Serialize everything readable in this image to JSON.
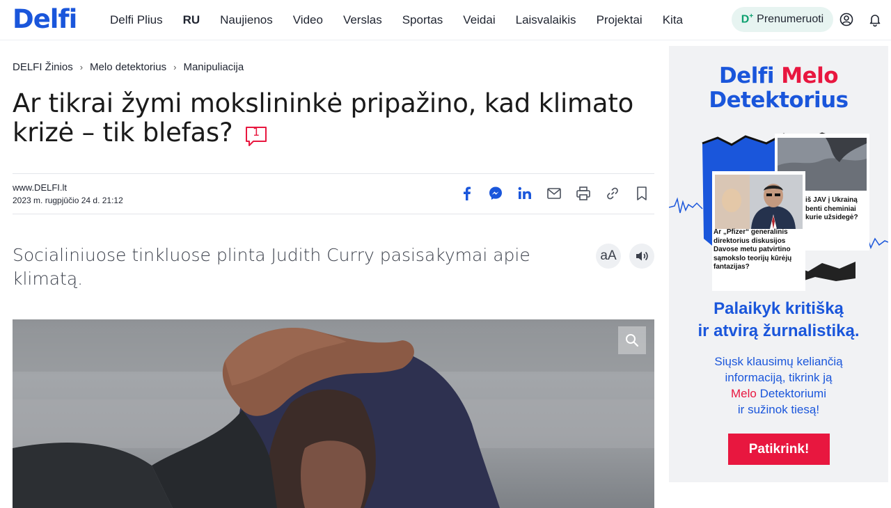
{
  "header": {
    "logo": "Delfi",
    "nav": [
      "Delfi Plius",
      "RU",
      "Naujienos",
      "Video",
      "Verslas",
      "Sportas",
      "Veidai",
      "Laisvalaikis",
      "Projektai",
      "Kita"
    ],
    "subscribe_mark": "D",
    "subscribe_label": "Prenumeruoti"
  },
  "breadcrumb": [
    "DELFI Žinios",
    "Melo detektorius",
    "Manipuliacija"
  ],
  "article": {
    "title": "Ar tikrai žymi mokslininkė pripažino, kad klimato krizė – tik blefas?",
    "comment_count": "1",
    "source": "www.DELFI.lt",
    "date": "2023 m. rugpjūčio 24 d. 21:12",
    "lead": "Socialiniuose tinkluose plinta Judith Curry pasisakymai apie klimatą.",
    "font_toggle": "aA"
  },
  "ad": {
    "title_a": "Delfi ",
    "title_b": "Melo",
    "title_c": "Detektorius",
    "card1_text": "Ar „Pfizer“ generalinis direktorius diskusijos Davose metu patvirtino sąmokslo teorijų kūrėjų fantazijas?",
    "card2_text": "iš JAV į Ukrainą benti cheminiai kurie užsidegė?",
    "headline_1": "Palaikyk kritišką",
    "headline_2": "ir atvirą žurnalistiką.",
    "body_1": "Siųsk klausimų keliančią",
    "body_2": "informaciją, tikrink ją",
    "body_3_red": "Melo",
    "body_3_rest": " Detektoriumi",
    "body_4": "ir sužinok tiesą!",
    "cta": "Patikrink!"
  },
  "colors": {
    "brand_blue": "#1a56db",
    "accent_red": "#e8173f",
    "plus_green": "#0da06f"
  }
}
